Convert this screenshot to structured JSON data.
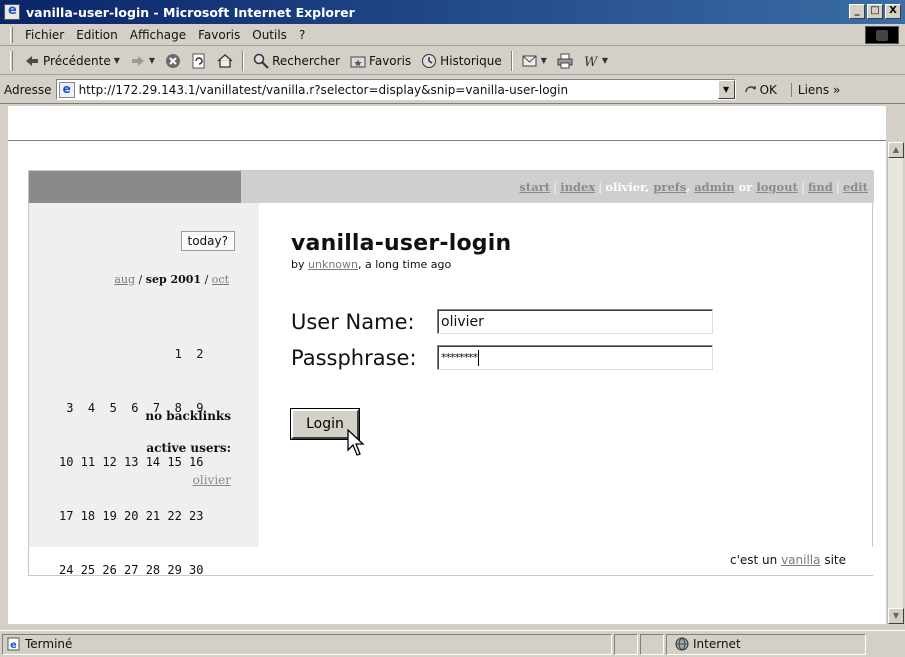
{
  "window": {
    "title": "vanilla-user-login - Microsoft Internet Explorer",
    "buttons": {
      "minimize": "_",
      "maximize": "□",
      "close": "X"
    }
  },
  "menubar": {
    "items": [
      "Fichier",
      "Edition",
      "Affichage",
      "Favoris",
      "Outils",
      "?"
    ]
  },
  "toolbar": {
    "back": "Précédente",
    "search": "Rechercher",
    "favorites": "Favoris",
    "history": "Historique"
  },
  "address": {
    "label": "Adresse",
    "url": "http://172.29.143.1/vanillatest/vanilla.r?selector=display&snip=vanilla-user-login",
    "go": "OK",
    "links": "Liens »"
  },
  "nav": {
    "start": "start",
    "index": "index",
    "user": "olivier",
    "prefs": "prefs",
    "admin": "admin",
    "or": "or",
    "logout": "logout",
    "find": "find",
    "edit": "edit"
  },
  "sidebar": {
    "today": "today?",
    "prev_month": "aug",
    "current": "sep 2001",
    "next_month": "oct",
    "calendar_rows": [
      "                1  2",
      " 3  4  5  6  7  8  9",
      "10 11 12 13 14 15 16",
      "17 18 19 20 21 22 23",
      "24 25 26 27 28 29 30"
    ],
    "backlinks": "no backlinks",
    "active_users_label": "active users:",
    "active_user": "olivier"
  },
  "snip": {
    "title": "vanilla-user-login",
    "by": "by",
    "author": "unknown",
    "when": ", a long time ago"
  },
  "form": {
    "username_label": "User Name:",
    "username_value": "olivier",
    "passphrase_label": "Passphrase:",
    "passphrase_value": "********",
    "login_button": "Login"
  },
  "footer": {
    "prefix": "c'est un",
    "link": "vanilla",
    "suffix": "site"
  },
  "status": {
    "text": "Terminé",
    "zone": "Internet"
  }
}
